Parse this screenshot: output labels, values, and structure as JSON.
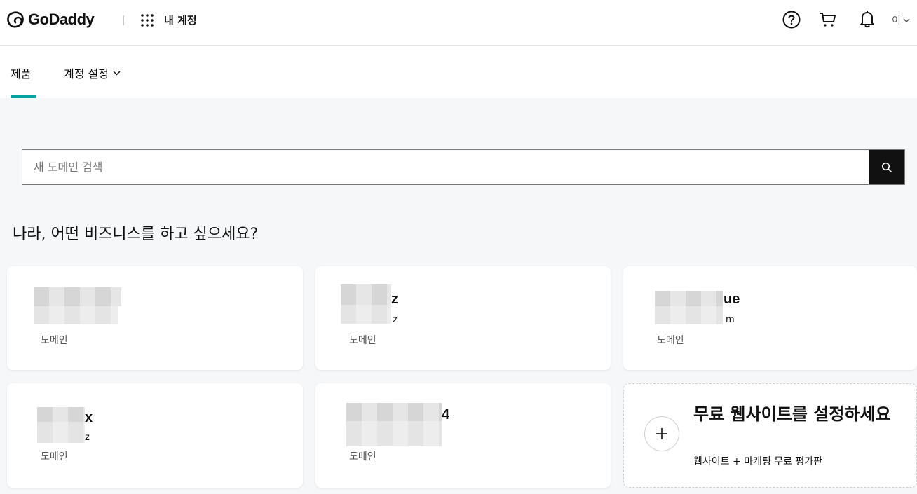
{
  "header": {
    "logo_text": "GoDaddy",
    "app_title": "내 계정",
    "user_initial": "이"
  },
  "subnav": {
    "tabs": [
      {
        "label": "제품",
        "active": true
      },
      {
        "label": "계정 설정"
      }
    ],
    "accent": "#00a4a6"
  },
  "search": {
    "placeholder": "새 도메인 검색",
    "value": ""
  },
  "greeting": "나라, 어떤 비즈니스를 하고 싶으세요?",
  "domains": [
    {
      "name_fragment": "",
      "sub_fragment": "",
      "label": "도메인"
    },
    {
      "name_fragment": "z",
      "sub_fragment": "z",
      "label": "도메인"
    },
    {
      "name_fragment": "ue",
      "sub_fragment": "m",
      "label": "도메인"
    },
    {
      "name_fragment": "x",
      "sub_fragment": "z",
      "label": "도메인"
    },
    {
      "name_fragment": "4",
      "sub_fragment": "",
      "label": "도메인"
    }
  ],
  "website_cta": {
    "title": "무료 웹사이트를 설정하세요",
    "subtitle": "웹사이트 + 마케팅 무료 평가판"
  },
  "icons": [
    "godaddy-logo-icon",
    "apps-grid-icon",
    "help-icon",
    "cart-icon",
    "bell-icon",
    "chevron-down-icon",
    "search-icon",
    "plus-icon"
  ]
}
